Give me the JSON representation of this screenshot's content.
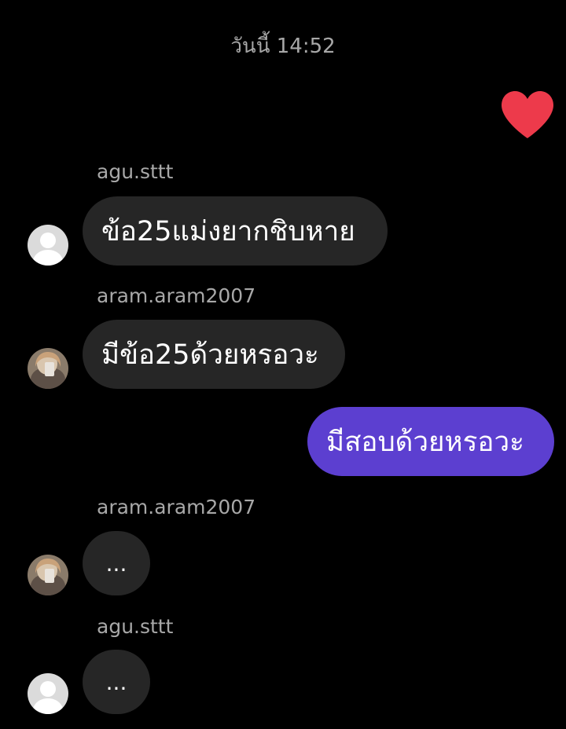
{
  "header": {
    "timestamp": "วันนี้ 14:52"
  },
  "reaction": {
    "icon": "heart-icon",
    "color": "#ed3a4b"
  },
  "messages": [
    {
      "sender": "agu.sttt",
      "text": "ข้อ25แม่งยากชิบหาย",
      "direction": "incoming",
      "avatar": "default-avatar-icon"
    },
    {
      "sender": "aram.aram2007",
      "text": "มีข้อ25ด้วยหรอวะ",
      "direction": "incoming",
      "avatar": "photo-avatar"
    },
    {
      "sender": "",
      "text": "มีสอบด้วยหรอวะ",
      "direction": "outgoing"
    },
    {
      "sender": "aram.aram2007",
      "text": "...",
      "direction": "incoming",
      "avatar": "photo-avatar"
    },
    {
      "sender": "agu.sttt",
      "text": "...",
      "direction": "incoming",
      "avatar": "default-avatar-icon"
    }
  ],
  "colors": {
    "background": "#000000",
    "incoming_bubble": "#262626",
    "outgoing_bubble": "#5c3fd0",
    "meta_text": "#a8a8a8"
  }
}
